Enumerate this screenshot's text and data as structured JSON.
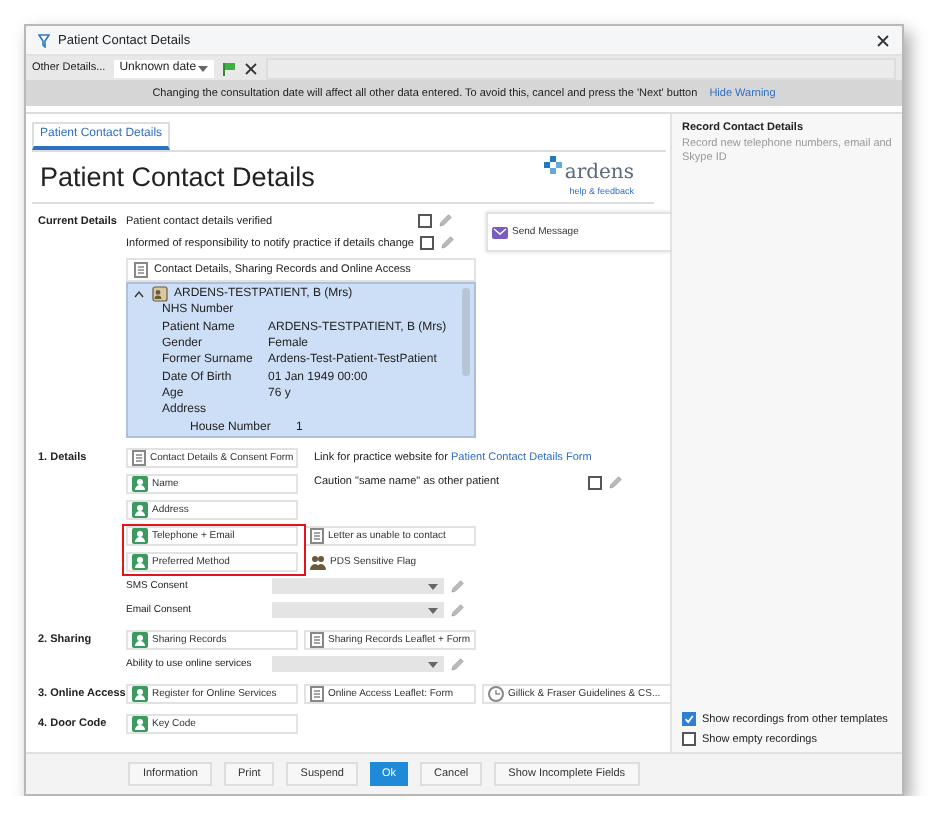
{
  "window": {
    "title": "Patient Contact Details"
  },
  "toolbar": {
    "label": "Other Details...",
    "date": "Unknown date"
  },
  "warning": {
    "text": "Changing the consultation date will affect all other data entered. To avoid this, cancel and press the 'Next' button",
    "link": "Hide Warning"
  },
  "tabs": [
    {
      "label": "Patient Contact Details",
      "selected": true
    }
  ],
  "heading": "Patient Contact Details",
  "logo": {
    "wordmark": "ardens",
    "tagline": "help & feedback"
  },
  "sections": [
    {
      "label": "Current Details",
      "rows": [
        {
          "cells": [
            {
              "kind": "checks",
              "items": [
                {
                  "label": "Patient contact details verified",
                  "checked": false
                },
                {
                  "label": "Informed of responsibility to notify practice if details change",
                  "checked": false
                }
              ]
            },
            {
              "kind": "message",
              "label": "Send Message"
            }
          ]
        },
        {
          "cells": [
            {
              "kind": "panel",
              "title": "Contact Details, Sharing Records and Online Access",
              "tree": [
                {
                  "label": "ARDENS-TESTPATIENT, B (Mrs)",
                  "expanded": true,
                  "children": [
                    {
                      "label": "NHS Number"
                    },
                    {
                      "label": "Patient Name",
                      "value": "ARDENS-TESTPATIENT, B (Mrs)"
                    },
                    {
                      "label": "Gender",
                      "value": "Female"
                    },
                    {
                      "label": "Former Surname",
                      "value": "Ardens-Test-Patient-TestPatient"
                    },
                    {
                      "label": "Date Of Birth",
                      "value": "01 Jan 1949 00:00"
                    },
                    {
                      "label": "Age",
                      "value": "76 y"
                    },
                    {
                      "label": "Address",
                      "children": [
                        {
                          "label": "House Number",
                          "value": "1"
                        }
                      ]
                    }
                  ]
                }
              ]
            }
          ]
        }
      ]
    },
    {
      "label": "1. Details",
      "rows": [
        {
          "cells": [
            {
              "kind": "form",
              "label": "Contact Details & Consent Form"
            },
            {
              "kind": "linktext",
              "text": "Link for practice website for ",
              "link": "Patient Contact Details Form"
            }
          ]
        },
        {
          "cells": [
            {
              "kind": "record",
              "label": "Name"
            },
            {
              "kind": "check",
              "label": "Caution \"same name\" as other patient",
              "checked": false
            }
          ]
        },
        {
          "cells": [
            {
              "kind": "record",
              "label": "Address"
            }
          ]
        },
        {
          "cells": [
            {
              "kind": "record",
              "label": "Telephone + Email",
              "highlighted": true
            },
            {
              "kind": "form",
              "label": "Letter as unable to contact"
            }
          ]
        },
        {
          "cells": [
            {
              "kind": "record",
              "label": "Preferred Method",
              "highlighted": true
            },
            {
              "kind": "plain",
              "label": "PDS Sensitive Flag"
            }
          ]
        },
        {
          "cells": [
            {
              "kind": "select",
              "label": "SMS Consent"
            }
          ]
        },
        {
          "cells": [
            {
              "kind": "select",
              "label": "Email Consent"
            }
          ]
        }
      ]
    },
    {
      "label": "2. Sharing",
      "rows": [
        {
          "cells": [
            {
              "kind": "record",
              "label": "Sharing Records"
            },
            {
              "kind": "form",
              "label": "Sharing Records Leaflet + Form"
            }
          ]
        },
        {
          "cells": [
            {
              "kind": "select",
              "label": "Ability to use online services"
            }
          ]
        }
      ]
    },
    {
      "label": "3. Online Access",
      "rows": [
        {
          "cells": [
            {
              "kind": "record",
              "label": "Register for Online Services"
            },
            {
              "kind": "form",
              "label": "Online Access Leaflet: Form"
            },
            {
              "kind": "guide",
              "label": "Gillick & Fraser Guidelines & CS..."
            }
          ]
        }
      ]
    },
    {
      "label": "4. Door Code",
      "rows": [
        {
          "cells": [
            {
              "kind": "record",
              "label": "Key Code"
            }
          ]
        }
      ]
    }
  ],
  "side": {
    "title": "Record Contact Details",
    "description": "Record new telephone numbers, email and Skype ID",
    "options": [
      {
        "label": "Show recordings from other templates",
        "checked": true
      },
      {
        "label": "Show empty recordings",
        "checked": false
      }
    ]
  },
  "buttons": [
    {
      "label": "Information",
      "primary": false
    },
    {
      "label": "Print",
      "primary": false
    },
    {
      "label": "Suspend",
      "primary": false
    },
    {
      "label": "Ok",
      "primary": true
    },
    {
      "label": "Cancel",
      "primary": false
    },
    {
      "label": "Show Incomplete Fields",
      "primary": false
    }
  ]
}
